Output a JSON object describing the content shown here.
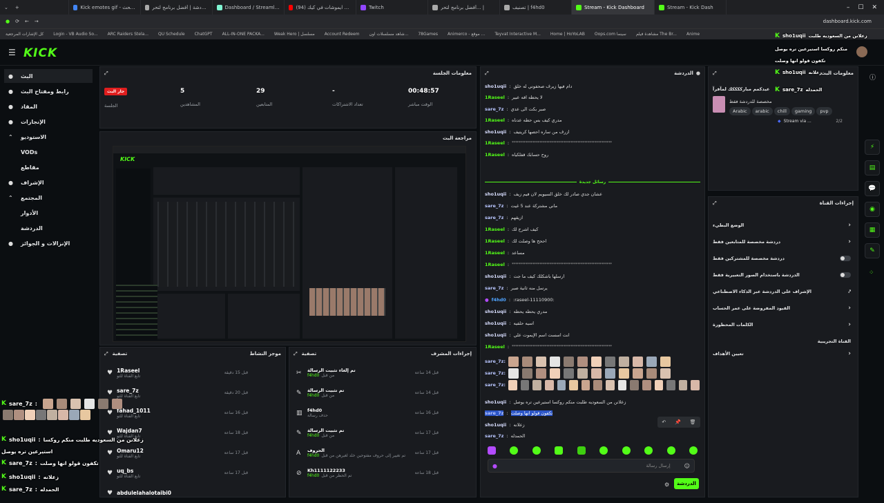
{
  "browser": {
    "tabs": [
      {
        "label": "Kick emotes gif - بحث Google",
        "color": "#4285f4"
      },
      {
        "label": "بوت الدردشة | أفضل برنامج لتحر...",
        "color": "#aaa"
      },
      {
        "label": "Dashboard / Streamlabs",
        "color": "#80f5d2"
      },
      {
        "label": "كيف اخلط ايموشات في كيك (94)",
        "color": "#ff0000"
      },
      {
        "label": "Twitch",
        "color": "#9146ff"
      },
      {
        "label": "أفضل برنامج لتحر... |",
        "color": "#aaa"
      },
      {
        "label": "تصنيف | f4hd0",
        "color": "#aaa"
      },
      {
        "label": "Stream - Kick Dashboard",
        "color": "#53fc18"
      },
      {
        "label": "Stream - Kick Dash",
        "color": "#53fc18"
      }
    ],
    "url": "dashboard.kick.com",
    "bookmarks": [
      "كل الإشارات المرجعية",
      "Login - VB Audio So...",
      "ARC Raiders Stela...",
      "QU Schedule",
      "ChatGPT",
      "ALL-IN-ONE PACKA...",
      "Weak Hero | مسلسل",
      "Account Redeem",
      "شاهد مسلسلات اون...",
      "78Games",
      "Animerco - موقع ...",
      "Teyvat Interactive M...",
      "Home | HoYoLAB",
      "Oops.com سينما",
      "مشاهدة فيلم The Br...",
      "Anime"
    ]
  },
  "nav": {
    "logo": "KICK"
  },
  "sidebar": {
    "items": [
      {
        "label": "البث",
        "icon": "broadcast-icon"
      },
      {
        "label": "رابط ومفتاح البث",
        "icon": "link-icon"
      },
      {
        "label": "المقاد",
        "icon": "grid-icon"
      },
      {
        "label": "الإنجازات",
        "icon": "trophy-icon"
      },
      {
        "label": "الاستوديو",
        "icon": "chevron-up-icon"
      },
      {
        "label": "VODs",
        "icon": ""
      },
      {
        "label": "مقاطع",
        "icon": ""
      },
      {
        "label": "الإشراف",
        "icon": "wrench-icon"
      },
      {
        "label": "المجتمع",
        "icon": "chevron-up-icon"
      },
      {
        "label": "الأدوار",
        "icon": ""
      },
      {
        "label": "الدردشة",
        "icon": ""
      },
      {
        "label": "الإنزالات و الجوائز",
        "icon": "gift-icon"
      }
    ]
  },
  "session": {
    "title": "معلومات الجلسة",
    "live_badge": "جار البث",
    "live_label": "الجلسة",
    "stats": [
      {
        "value": "5",
        "label": "المشاهدين"
      },
      {
        "value": "29",
        "label": "المتابعين"
      },
      {
        "value": "-",
        "label": "تعداد الاشتراكات"
      },
      {
        "value": "00:48:57",
        "label": "الوقت مباشر"
      }
    ]
  },
  "preview": {
    "title": "مراجعة البث"
  },
  "activity": {
    "title": "موجز النشاط",
    "filter": "تصفية",
    "items": [
      {
        "name": "1Raseel",
        "sub": "تابع القناة للتو",
        "time": "قبل 15 دقيقة"
      },
      {
        "name": "sare_7z",
        "sub": "تابع القناة للتو",
        "time": "قبل 20 دقيقة"
      },
      {
        "name": "fahad_1011",
        "sub": "تابع القناة للتو",
        "time": "قبل 16 ساعة"
      },
      {
        "name": "Wajdan7",
        "sub": "تابع القناة للتو",
        "time": "قبل 18 ساعة"
      },
      {
        "name": "Omaru12",
        "sub": "تابع القناة للتو",
        "time": "قبل 17 ساعة"
      },
      {
        "name": "uq_bs",
        "sub": "تابع القناة للتو",
        "time": "قبل 17 ساعة"
      },
      {
        "name": "abdulelahalotaibi0",
        "sub": "",
        "time": ""
      }
    ]
  },
  "modactions": {
    "title": "إجراءات المشرف",
    "filter": "تصفية",
    "items": [
      {
        "title": "تم إلغاء تثبيت الرسالة",
        "by": "من قبل",
        "user": "f4hd0",
        "time": "قبل 14 ساعة",
        "icon": "unpin-icon"
      },
      {
        "title": "تم تثبيت الرسالة",
        "by": "من قبل",
        "user": "f4hd0",
        "time": "قبل 14 ساعة",
        "icon": "pin-icon"
      },
      {
        "title": "f4hd0",
        "by": "حذف رسالة",
        "user": "",
        "time": "قبل 16 ساعة",
        "icon": "trash-icon"
      },
      {
        "title": "تم تثبيت الرسالة",
        "by": "من قبل",
        "user": "f4hd0",
        "time": "قبل 17 ساعة",
        "icon": "pin-icon"
      },
      {
        "title": "الحروف",
        "by": "تم تغيير إلى حروف مفتوحين خلد لغيرهن من قبل",
        "user": "f4hd0",
        "time": "قبل 17 ساعة",
        "icon": "font-icon"
      },
      {
        "title": "Kh1111122233",
        "by": "تم الحظر من قبل",
        "user": "f4hd0",
        "time": "قبل 18 ساعة",
        "icon": "ban-icon"
      }
    ]
  },
  "chat": {
    "title": "الدردشة",
    "new_messages": "رسائل جديدة",
    "input_placeholder": "إرسال رسالة",
    "send_label": "الدردشة",
    "lines_top": [
      {
        "user": "sho1uqii",
        "msg": "دام فيها زيرف صحفوني له خلق"
      },
      {
        "user": "1Raseel",
        "msg": "لا يحطه اقه عبير"
      },
      {
        "user": "sare_7z",
        "msg": "صبر بكت الى عدي"
      },
      {
        "user": "1Raseel",
        "msg": "مدري كيف بس حطه عدناه"
      },
      {
        "user": "sho1uqii",
        "msg": "ازرف من ساره احصها كريتيف"
      },
      {
        "user": "1Raseel",
        "msg": "**********************************************************"
      },
      {
        "user": "1Raseel",
        "msg": "روح حسابك قفلكياه"
      }
    ],
    "lines_bottom": [
      {
        "user": "sho1uqii",
        "msg": "عشان جدي صادر لك خلق السيويم لان فيم زيف"
      },
      {
        "user": "sare_7z",
        "msg": "ماني مشتركة عند 5 غيت"
      },
      {
        "user": "sare_7z",
        "msg": "ازيقهم"
      },
      {
        "user": "1Raseel",
        "msg": "كيف اشرح لك"
      },
      {
        "user": "1Raseel",
        "msg": "اححح ها وصلت لك"
      },
      {
        "user": "1Raseel",
        "msg": "مساعد"
      },
      {
        "user": "1Raseel",
        "msg": "**********************************************************"
      },
      {
        "user": "sho1uqii",
        "msg": "ارسلها باشكلك كيف ما جت"
      },
      {
        "user": "sare_7z",
        "msg": "يرسل منه ثانية صبر"
      },
      {
        "user": "f4hd0",
        "msg": ":raseel-11110900:"
      },
      {
        "user": "sho1uqii",
        "msg": "مدري يحطه يحطه"
      },
      {
        "user": "sho1uqii",
        "msg": "اسيه حلفيه"
      },
      {
        "user": "sho1uqii",
        "msg": "انت اسست اسم الإيموت علي"
      },
      {
        "user": "1Raseel",
        "msg": "**********************************************************"
      }
    ],
    "emote_rows": [
      "sare_7z:",
      "sare_7z:",
      "sare_7z:"
    ],
    "lines_last": [
      {
        "user": "sho1uqii",
        "msg": "زعلانن من السعوديه طلبت منكم روكسا استيرعين تره يوصل"
      },
      {
        "user": "sare_7z",
        "msg": "تكفون قولو انها وصلت"
      },
      {
        "user": "sho1uqii",
        "msg": "زعلانه"
      },
      {
        "user": "sare_7z",
        "msg": "الحمدله"
      }
    ]
  },
  "streaminfo": {
    "title": "معلومات البث",
    "stream_title": "عيدكمم مبارككككك لمآفرآ",
    "category": "مخصصة للدردشة فقط",
    "tags": [
      "Arabic",
      "arabic",
      "chill",
      "gaming",
      "pvp"
    ],
    "via": "Stream via ...",
    "page": "2/2"
  },
  "channelactions": {
    "title": "إجراءات القناة",
    "rows": [
      {
        "label": "الوضع البطيء",
        "control": "chevron"
      },
      {
        "label": "دردشة مخصصة للمتابعين فقط",
        "control": "chevron"
      },
      {
        "label": "دردشة مخصصة للمشتركين فقط",
        "control": "toggle"
      },
      {
        "label": "الدردشة باستخدام الصور التعبيرية فقط",
        "control": "toggle"
      },
      {
        "label": "الإشراف على الدردشة عبر الذكاء الاصطناعي",
        "control": "link"
      },
      {
        "label": "القيود المفروضة على عمر الحساب",
        "control": "chevron"
      },
      {
        "label": "الكلمات المحظورة",
        "control": "chevron"
      },
      {
        "label": "القناة التجريبية",
        "control": "none"
      },
      {
        "label": "تعيين الأهداف",
        "control": "chevron"
      }
    ]
  },
  "overlay": {
    "lines": [
      {
        "user": "sare_7z",
        "text": ""
      },
      {
        "user": "sho1uqii",
        "text": "زعلانن من السعوديه طلبت منكم روكسا"
      },
      {
        "user": "",
        "text": "استيرعين تره يوصل"
      },
      {
        "user": "sare_7z",
        "text": "تكفون قولو انها وصلت"
      },
      {
        "user": "sho1uqii",
        "text": "زعلانه"
      },
      {
        "user": "sare_7z",
        "text": "الحمدله"
      }
    ],
    "top_lines": [
      {
        "user": "sho1uqii",
        "text": "زعلانن من السعوديه طلبت"
      },
      {
        "user": "",
        "text": "منكم روكسا استيرعين تره يوصل"
      },
      {
        "user": "",
        "text": "تكفون قولو انها وصلت"
      },
      {
        "user": "sho1uqii",
        "text": "زعلانه"
      },
      {
        "user": "sare_7z",
        "text": "الحمدله"
      }
    ]
  },
  "colors": {
    "accent": "#53fc18",
    "live": "#e01e1e",
    "bg": "#0b0e11",
    "panel": "#191b1f"
  }
}
